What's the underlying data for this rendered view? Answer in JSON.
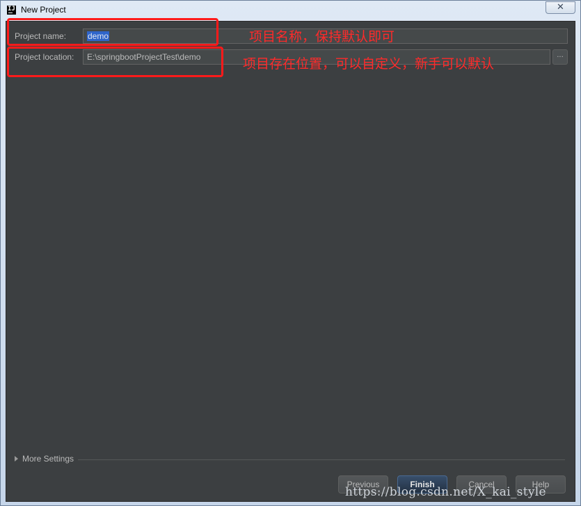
{
  "window": {
    "title": "New Project",
    "app_icon": "intellij-icon",
    "close_icon": "close-icon",
    "close_glyph": "✕"
  },
  "form": {
    "name_label": "Project name:",
    "name_value": "demo",
    "location_label": "Project location:",
    "location_value": "E:\\springbootProjectTest\\demo",
    "browse_label": "..."
  },
  "annotations": {
    "name_note": "项目名称，保持默认即可",
    "location_note": "项目存在位置，可以自定义，新手可以默认"
  },
  "more_settings": {
    "label": "More Settings",
    "icon": "expand-triangle-icon"
  },
  "buttons": {
    "previous": "Previous",
    "finish": "Finish",
    "cancel": "Cancel",
    "help": "Help"
  },
  "watermark": "https://blog.csdn.net/X_kai_style",
  "colors": {
    "content_bg": "#3c3f41",
    "annotation_red": "#ff1a1a",
    "selection": "#2f65ca"
  }
}
